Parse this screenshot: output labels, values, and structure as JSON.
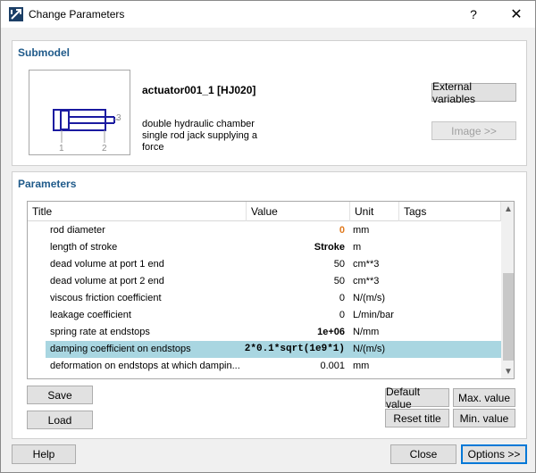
{
  "window": {
    "title": "Change Parameters",
    "help_glyph": "?",
    "close_glyph": "✕"
  },
  "submodel": {
    "group_title": "Submodel",
    "name": "actuator001_1 [HJ020]",
    "description": "double hydraulic chamber single rod jack supplying a force",
    "external_variables_label": "External variables",
    "image_label": "Image >>",
    "port_labels": [
      "1",
      "2",
      "3"
    ]
  },
  "parameters": {
    "group_title": "Parameters",
    "columns": [
      "Title",
      "Value",
      "Unit",
      "Tags"
    ],
    "rows": [
      {
        "title": "rod diameter",
        "value": "0",
        "unit": "mm"
      },
      {
        "title": "length of stroke",
        "value": "Stroke",
        "unit": "m"
      },
      {
        "title": "dead volume at port 1 end",
        "value": "50",
        "unit": "cm**3"
      },
      {
        "title": "dead volume at port 2 end",
        "value": "50",
        "unit": "cm**3"
      },
      {
        "title": "viscous friction coefficient",
        "value": "0",
        "unit": "N/(m/s)"
      },
      {
        "title": "leakage coefficient",
        "value": "0",
        "unit": "L/min/bar"
      },
      {
        "title": "spring rate at endstops",
        "value": "1e+06",
        "unit": "N/mm"
      },
      {
        "title": "damping coefficient on endstops",
        "value": "2*0.1*sqrt(1e9*1)",
        "unit": "N/(m/s)"
      },
      {
        "title": "deformation on endstops at which dampin...",
        "value": "0.001",
        "unit": "mm"
      }
    ],
    "buttons": {
      "save": "Save",
      "load": "Load",
      "default_value": "Default value",
      "max_value": "Max. value",
      "reset_title": "Reset title",
      "min_value": "Min. value"
    }
  },
  "footer": {
    "help": "Help",
    "close": "Close",
    "options": "Options >>"
  },
  "colors": {
    "accent": "#1f5a8a",
    "selected_row": "#a9d6e1",
    "highlight_value": "#e07a1f",
    "schematic": "#1a1aa0"
  }
}
